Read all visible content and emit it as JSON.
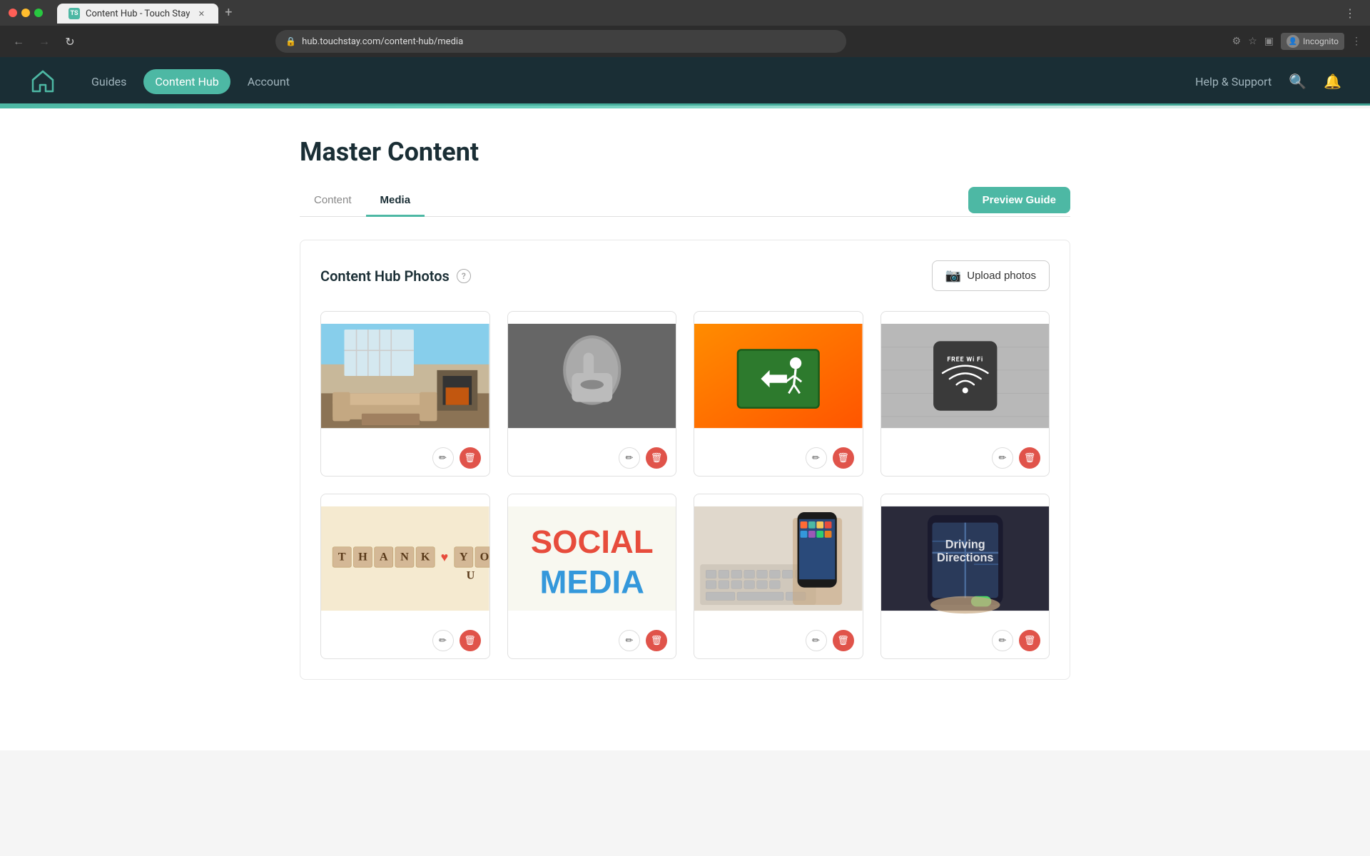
{
  "browser": {
    "tab_title": "Content Hub - Touch Stay",
    "tab_favicon": "TS",
    "url": "hub.touchstay.com/content-hub/media",
    "new_tab_label": "+",
    "incognito_label": "Incognito",
    "chevron_label": "›"
  },
  "navbar": {
    "logo_alt": "Touch Stay home",
    "guides_label": "Guides",
    "content_hub_label": "Content Hub",
    "account_label": "Account",
    "help_label": "Help & Support",
    "search_label": "search",
    "bell_label": "notifications"
  },
  "page": {
    "title": "Master Content",
    "tab_content": "Content",
    "tab_media": "Media",
    "preview_guide_btn": "Preview Guide"
  },
  "photos_section": {
    "title": "Content Hub Photos",
    "help_icon_label": "?",
    "upload_btn_label": "Upload photos",
    "upload_icon": "📷"
  },
  "photo_cards": [
    {
      "id": "card-1",
      "alt": "Modern living room with fireplace",
      "type": "living-room"
    },
    {
      "id": "card-2",
      "alt": "Person with finger on lips silence gesture",
      "type": "silence"
    },
    {
      "id": "card-3",
      "alt": "Emergency exit sign on orange background",
      "type": "exit"
    },
    {
      "id": "card-4",
      "alt": "Free WiFi sign on concrete wall",
      "type": "wifi"
    },
    {
      "id": "card-5",
      "alt": "Thank you scrabble tiles",
      "type": "thankyou"
    },
    {
      "id": "card-6",
      "alt": "Social Media colorful text",
      "type": "socialmedia"
    },
    {
      "id": "card-7",
      "alt": "Hand holding smartphone over keyboard",
      "type": "phone"
    },
    {
      "id": "card-8",
      "alt": "Driving Directions on phone screen",
      "type": "driving"
    }
  ],
  "icons": {
    "edit": "✏",
    "delete": "🗑",
    "camera": "📷",
    "search": "🔍",
    "bell": "🔔",
    "back": "←",
    "forward": "→",
    "reload": "↻",
    "lock": "🔒"
  }
}
